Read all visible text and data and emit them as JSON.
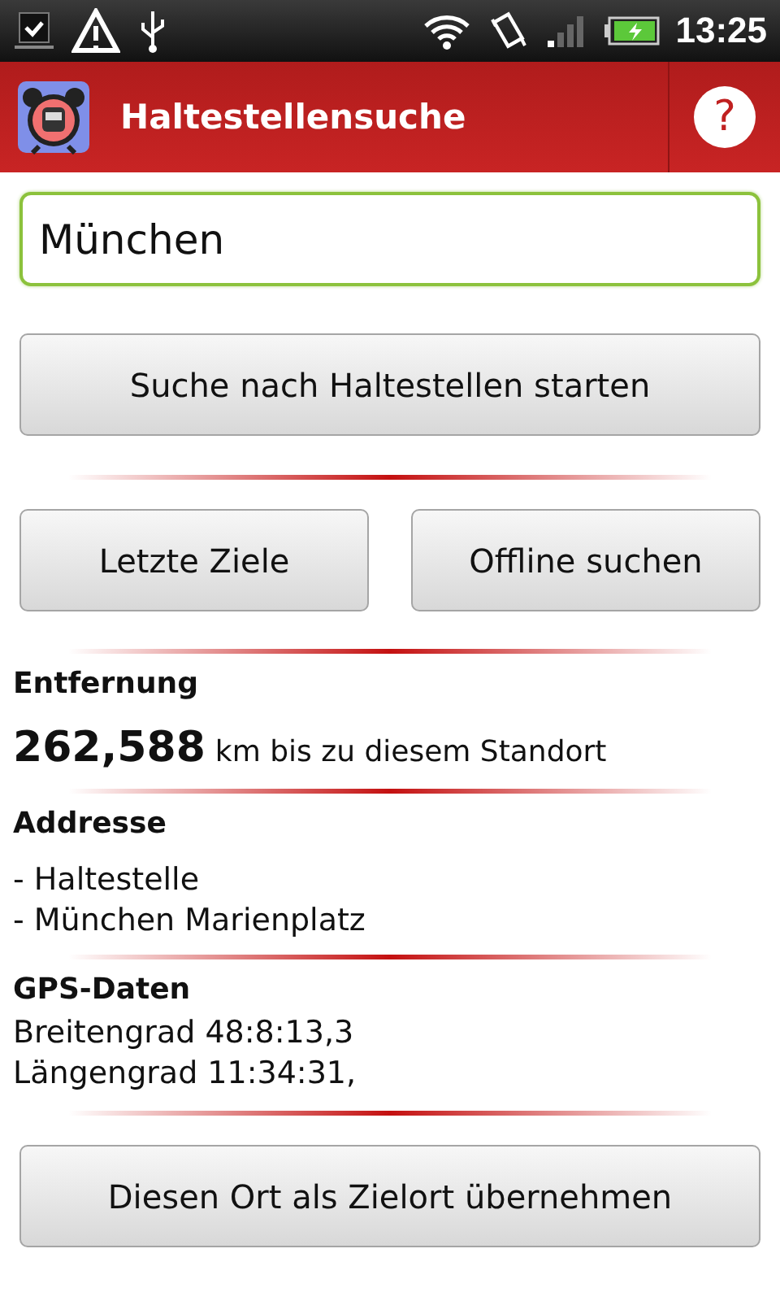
{
  "status_bar": {
    "time": "13:25"
  },
  "header": {
    "title": "Haltestellensuche",
    "help": "?"
  },
  "search": {
    "value": "München"
  },
  "search_button": "Suche nach Haltestellen starten",
  "buttons": [
    "Letzte Ziele",
    "Offline suchen"
  ],
  "sections": [
    {
      "kind": "distance",
      "heading": "Entfernung",
      "value": "262,588",
      "text": "km bis zu diesem Standort"
    },
    {
      "kind": "lines",
      "heading": "Addresse",
      "lines": [
        "- Haltestelle",
        "- München Marienplatz"
      ]
    },
    {
      "kind": "lines",
      "heading": "GPS-Daten",
      "lines": [
        "Breitengrad 48:8:13,3",
        "Längengrad 11:34:31,"
      ]
    }
  ],
  "bottom_button": "Diesen Ort als Zielort übernehmen"
}
